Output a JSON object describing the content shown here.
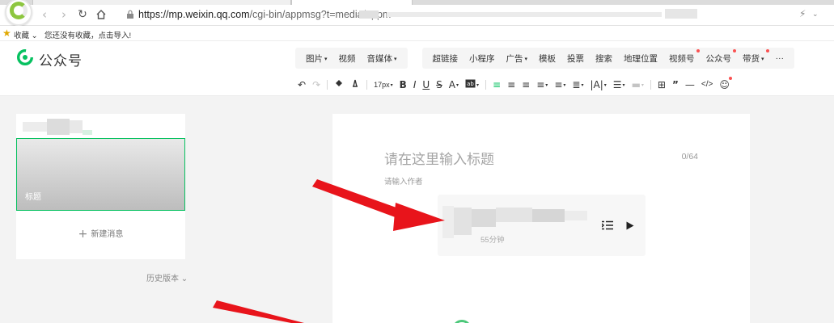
{
  "browser": {
    "url_main": "https://mp.weixin.qq.com",
    "url_rest": "/cgi-bin/appmsg?t=media/appm",
    "bookmarks": [
      {
        "label": "收藏"
      },
      {
        "label": "您还没有收藏，点击导入!"
      }
    ]
  },
  "header": {
    "logo_text": "公众号",
    "brand_color": "#07c160",
    "insert_groups": [
      [
        {
          "label": "图片",
          "caret": true
        },
        {
          "label": "视频"
        },
        {
          "label": "音频媒体",
          "display": "音媒体",
          "caret": true
        }
      ],
      [
        {
          "label": "超链接"
        },
        {
          "label": "小程序"
        },
        {
          "label": "广告",
          "caret": true
        },
        {
          "label": "模板"
        },
        {
          "label": "投票"
        },
        {
          "label": "搜索"
        },
        {
          "label": "地理位置"
        },
        {
          "label": "视频号",
          "dot": true
        },
        {
          "label": "公众号",
          "dot": true
        },
        {
          "label": "带货",
          "caret": true,
          "dot": true
        },
        {
          "label": "···"
        }
      ]
    ]
  },
  "format_toolbar": {
    "font_size": "17px"
  },
  "sidebar": {
    "cover_title": "标题",
    "new_message": "新建消息",
    "history": "历史版本"
  },
  "editor": {
    "title_placeholder": "请在这里输入标题",
    "title_count": "0/64",
    "author_placeholder": "请输入作者",
    "audio": {
      "duration": "55分钟"
    }
  }
}
